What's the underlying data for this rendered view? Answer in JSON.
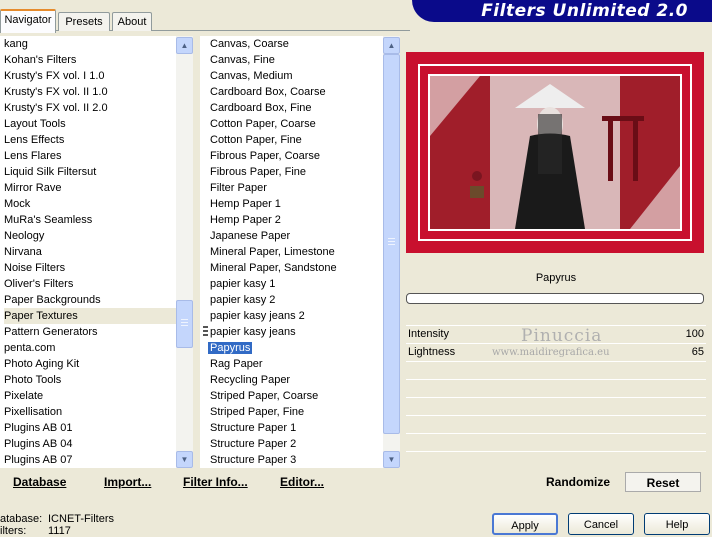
{
  "tabs": [
    "Navigator",
    "Presets",
    "About"
  ],
  "banner_title": "Filters Unlimited 2.0",
  "categories": [
    "kang",
    "Kohan's Filters",
    "Krusty's FX vol. I 1.0",
    "Krusty's FX vol. II 1.0",
    "Krusty's FX vol. II 2.0",
    "Layout Tools",
    "Lens Effects",
    "Lens Flares",
    "Liquid Silk Filtersut",
    "Mirror Rave",
    "Mock",
    "MuRa's Seamless",
    "Neology",
    "Nirvana",
    "Noise Filters",
    "Oliver's Filters",
    "Paper Backgrounds",
    "Paper Textures",
    "Pattern Generators",
    "penta.com",
    "Photo Aging Kit",
    "Photo Tools",
    "Pixelate",
    "Pixellisation",
    "Plugins AB 01",
    "Plugins AB 04",
    "Plugins AB 07"
  ],
  "selected_category": "Paper Textures",
  "filters": [
    "Canvas, Coarse",
    "Canvas, Fine",
    "Canvas, Medium",
    "Cardboard Box, Coarse",
    "Cardboard Box, Fine",
    "Cotton Paper, Coarse",
    "Cotton Paper, Fine",
    "Fibrous Paper, Coarse",
    "Fibrous Paper, Fine",
    "Filter Paper",
    "Hemp Paper 1",
    "Hemp Paper 2",
    "Japanese Paper",
    "Mineral Paper, Limestone",
    "Mineral Paper, Sandstone",
    "papier kasy 1",
    "papier kasy 2",
    "papier kasy jeans 2",
    "papier kasy jeans",
    "Papyrus",
    "Rag Paper",
    "Recycling Paper",
    "Striped Paper, Coarse",
    "Striped Paper, Fine",
    "Structure Paper 1",
    "Structure Paper 2",
    "Structure Paper 3"
  ],
  "selected_filter": "Papyrus",
  "bottom_buttons": {
    "database": "Database",
    "import": "Import...",
    "filter_info": "Filter Info...",
    "editor": "Editor..."
  },
  "filter_name": "Papyrus",
  "controls": [
    {
      "label": "Intensity",
      "value": "100"
    },
    {
      "label": "Lightness",
      "value": "65"
    }
  ],
  "watermark": {
    "name": "Pinuccia",
    "url": "www.maidiregrafica.eu"
  },
  "randomize_label": "Randomize",
  "reset_label": "Reset",
  "info": {
    "database_label": "atabase:",
    "database_value": "ICNET-Filters",
    "filters_label": "ilters:",
    "filters_value": "1117"
  },
  "dialog_buttons": {
    "apply": "Apply",
    "cancel": "Cancel",
    "help": "Help"
  },
  "colors": {
    "selection": "#316ac5",
    "banner": "#0a0a8a",
    "frame_red": "#c8102e"
  }
}
